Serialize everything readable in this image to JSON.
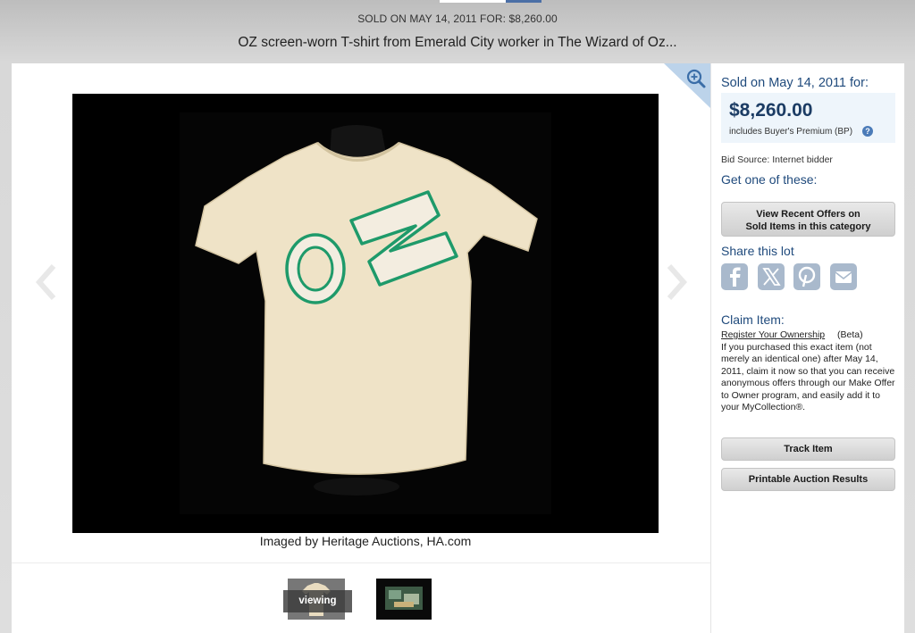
{
  "header": {
    "sold_line": "SOLD ON MAY 14, 2011 FOR: $8,260.00",
    "title": "OZ screen-worn T-shirt from Emerald City worker in The Wizard of Oz..."
  },
  "viewer": {
    "caption": "Imaged by Heritage Auctions, HA.com",
    "viewing_label": "viewing",
    "shirt_text": "OZ",
    "icons": [
      "zoom-in-icon",
      "chevron-left-icon",
      "chevron-right-icon"
    ]
  },
  "sidebar": {
    "sold_label": "Sold on May 14, 2011 for:",
    "price": "$8,260.00",
    "premium_note": "includes Buyer's Premium (BP)",
    "help_glyph": "?",
    "bid_source": "Bid Source: Internet bidder",
    "get_one": "Get one of these:",
    "offers_button_line1": "View Recent Offers on",
    "offers_button_line2": "Sold Items in this category",
    "share_label": "Share this lot",
    "share_icons": [
      "facebook-icon",
      "x-icon",
      "pinterest-icon",
      "email-icon"
    ],
    "claim_title": "Claim Item:",
    "register_link": "Register Your Ownership",
    "beta": "(Beta)",
    "claim_body": "If you purchased this exact item (not merely an identical one) after May 14, 2011, claim it now so that you can receive anonymous offers through our Make Offer to Owner program, and easily add it to your MyCollection®.",
    "track_button": "Track Item",
    "print_button": "Printable Auction Results"
  },
  "colors": {
    "accent": "#1f4a7c",
    "price_box": "#eef5fb",
    "shirt": "#efe3c7",
    "oz_outline": "#1e9a6a"
  }
}
